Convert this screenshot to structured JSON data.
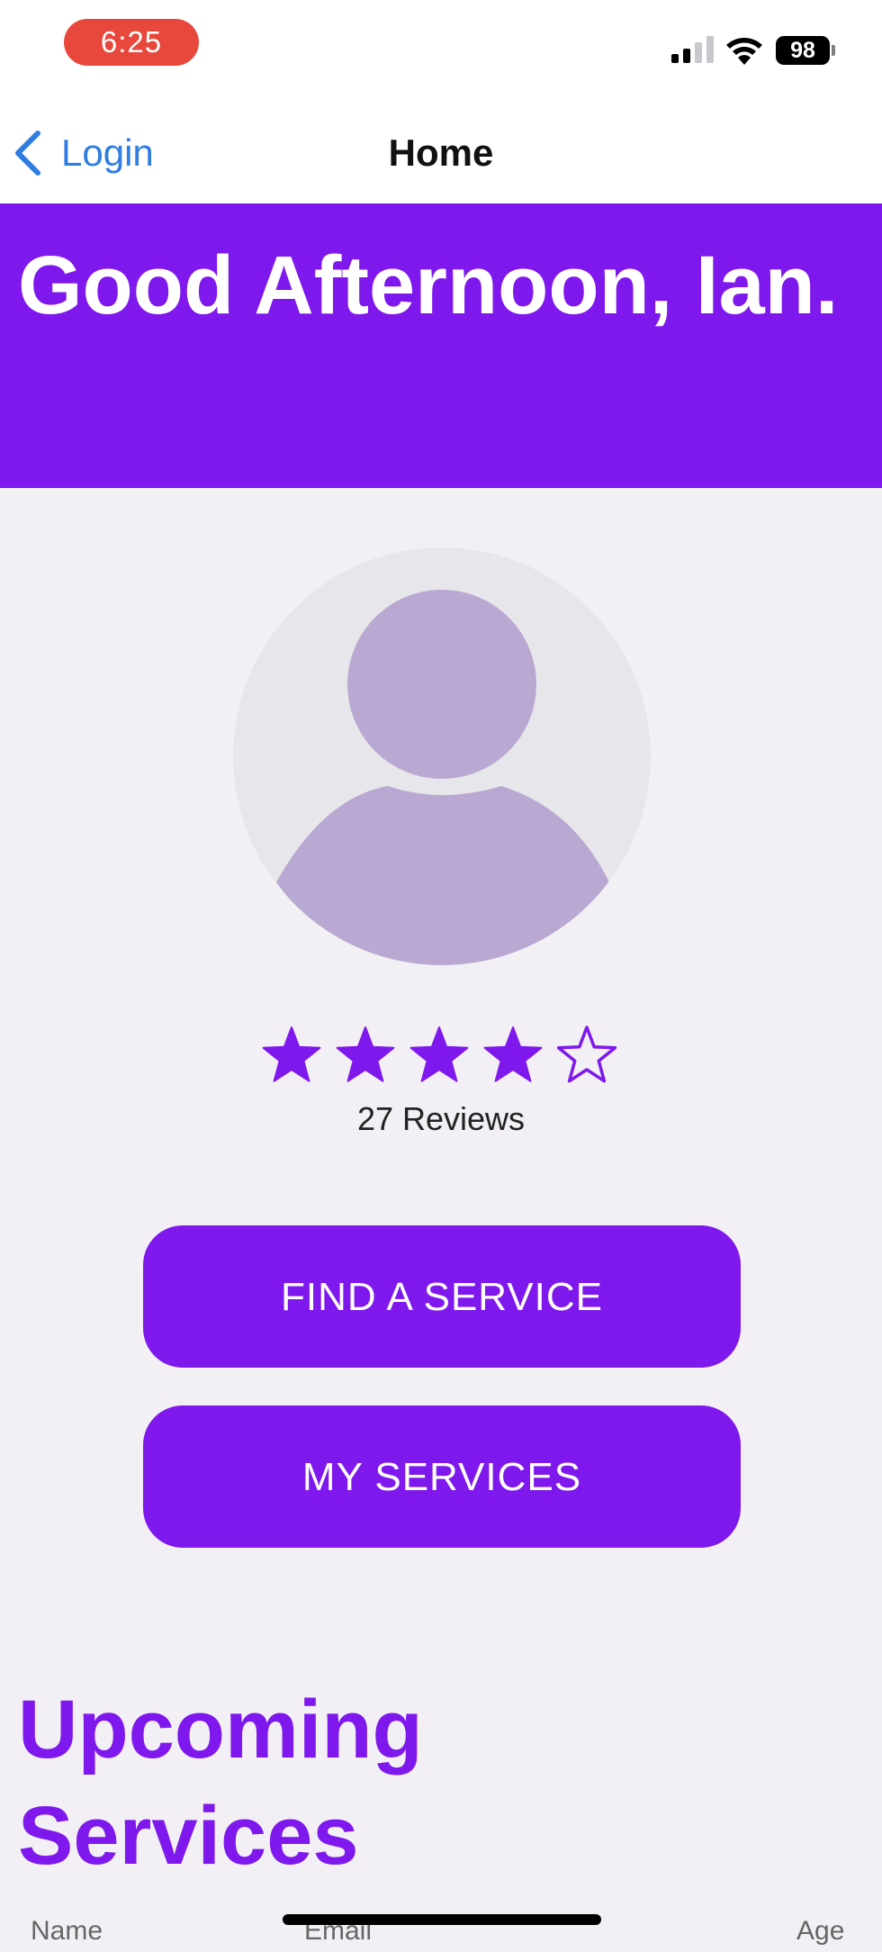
{
  "status_bar": {
    "time": "6:25",
    "battery": "98"
  },
  "nav": {
    "back_label": "Login",
    "title": "Home"
  },
  "greeting": {
    "text": "Good Afternoon, Ian."
  },
  "rating": {
    "stars": 4,
    "max_stars": 5,
    "reviews_label": "27 Reviews"
  },
  "buttons": {
    "find_service": "FIND A SERVICE",
    "my_services": "MY SERVICES"
  },
  "upcoming": {
    "title": "Upcoming Services",
    "columns": [
      "Name",
      "Email",
      "Age"
    ]
  },
  "colors": {
    "accent": "#7e18ec",
    "link": "#2f7de1",
    "time_pill": "#e8483b",
    "avatar_figure": "#b9a9d2",
    "avatar_bg": "#e7e6ea"
  },
  "icons": {
    "back": "chevron-left-icon",
    "signal": "cellular-signal-icon",
    "wifi": "wifi-icon",
    "battery": "battery-icon",
    "avatar": "person-silhouette-icon",
    "star_filled": "star-filled-icon",
    "star_empty": "star-outline-icon"
  }
}
